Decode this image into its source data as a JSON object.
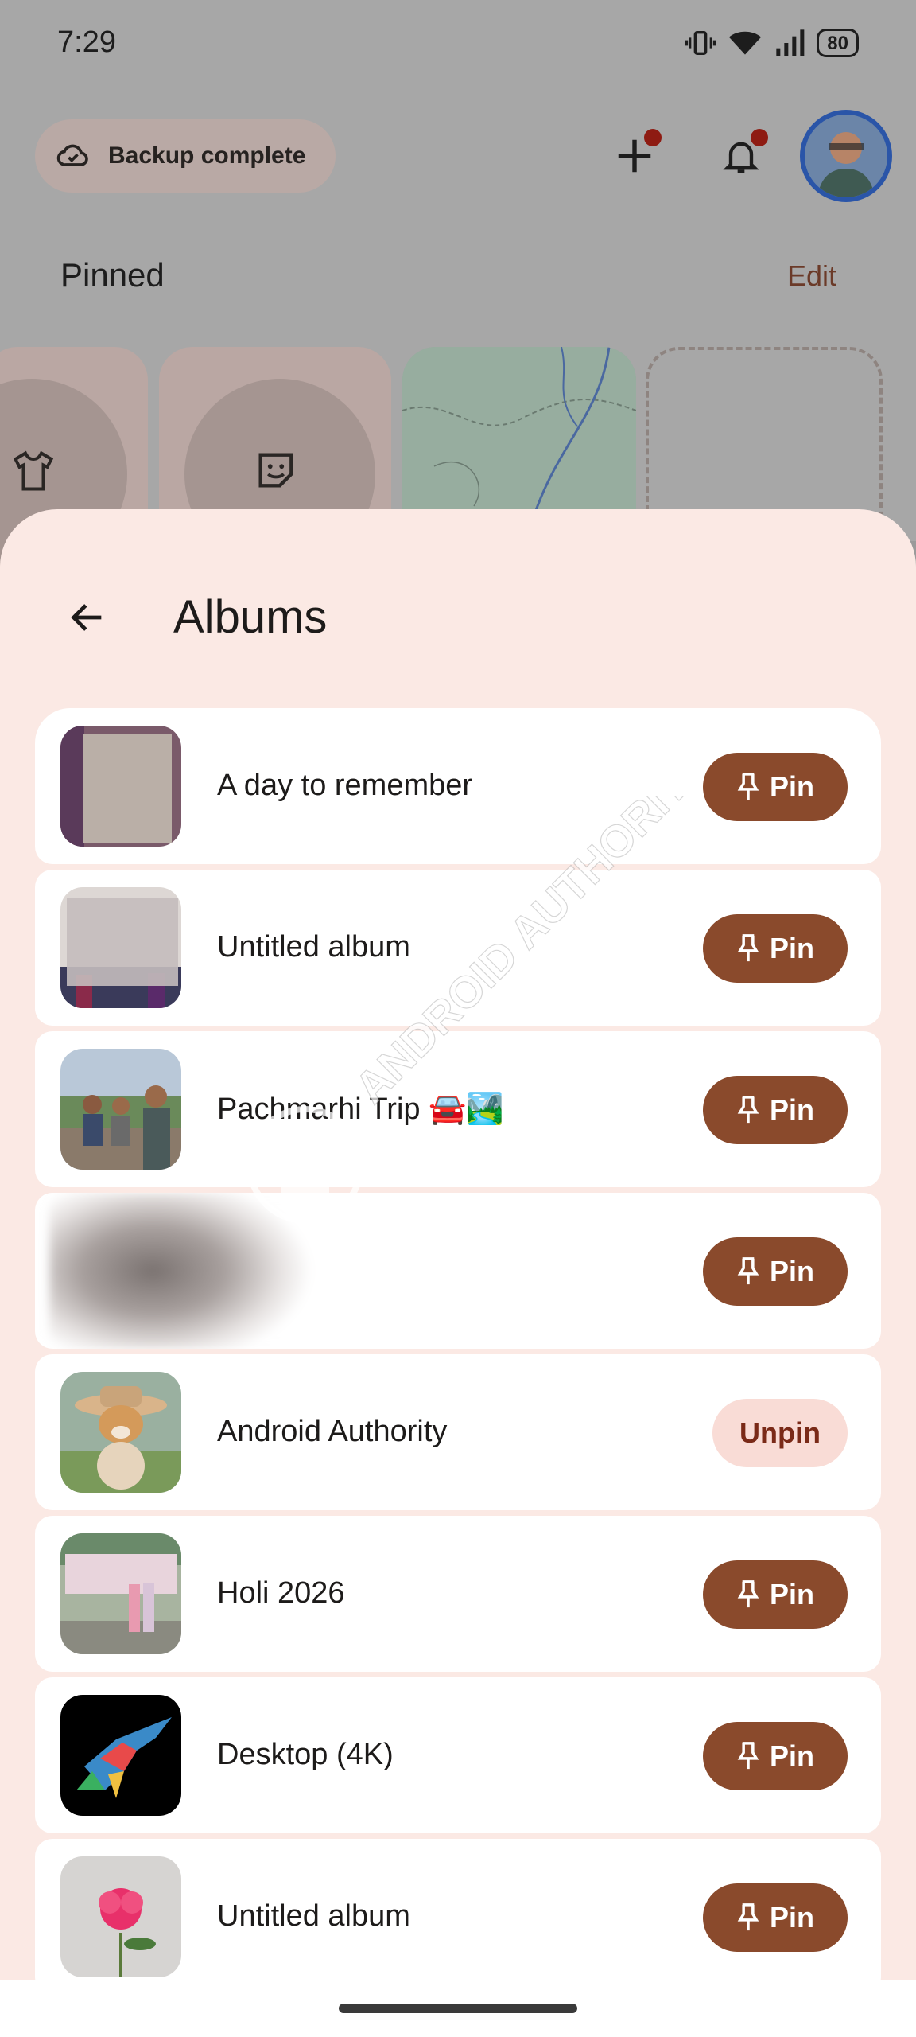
{
  "status_bar": {
    "time": "7:29",
    "battery": "80",
    "icons": [
      "vibrate-icon",
      "wifi-icon",
      "signal-icon",
      "battery-icon"
    ]
  },
  "top_bar": {
    "backup_label": "Backup complete",
    "backup_icon": "cloud-check-icon",
    "create_icon": "plus-icon",
    "notifications_icon": "bell-icon"
  },
  "pinned": {
    "title": "Pinned",
    "edit_label": "Edit",
    "cards": [
      "tshirt-icon",
      "sticker-icon",
      "map-thumbnail",
      "add-placeholder"
    ]
  },
  "sheet": {
    "title": "Albums",
    "back_icon": "arrow-back-icon"
  },
  "albums": [
    {
      "name": "A day to remember",
      "action": "Pin",
      "pinned": false
    },
    {
      "name": "Untitled album",
      "action": "Pin",
      "pinned": false
    },
    {
      "name": "Pachmarhi Trip 🚘🏞️",
      "action": "Pin",
      "pinned": false
    },
    {
      "name": "",
      "action": "Pin",
      "pinned": false
    },
    {
      "name": "Android Authority",
      "action": "Unpin",
      "pinned": true
    },
    {
      "name": "Holi 2026",
      "action": "Pin",
      "pinned": false
    },
    {
      "name": "Desktop (4K)",
      "action": "Pin",
      "pinned": false
    },
    {
      "name": "Untitled album",
      "action": "Pin",
      "pinned": false
    }
  ],
  "watermark": {
    "text": "ANDROID AUTHORITY"
  },
  "colors": {
    "sheet_bg": "#fbe9e4",
    "pin_button": "#8a4a2c",
    "unpin_button": "#f9dcd6",
    "unpin_text": "#7a2a18",
    "notification_dot": "#8e1b12"
  }
}
